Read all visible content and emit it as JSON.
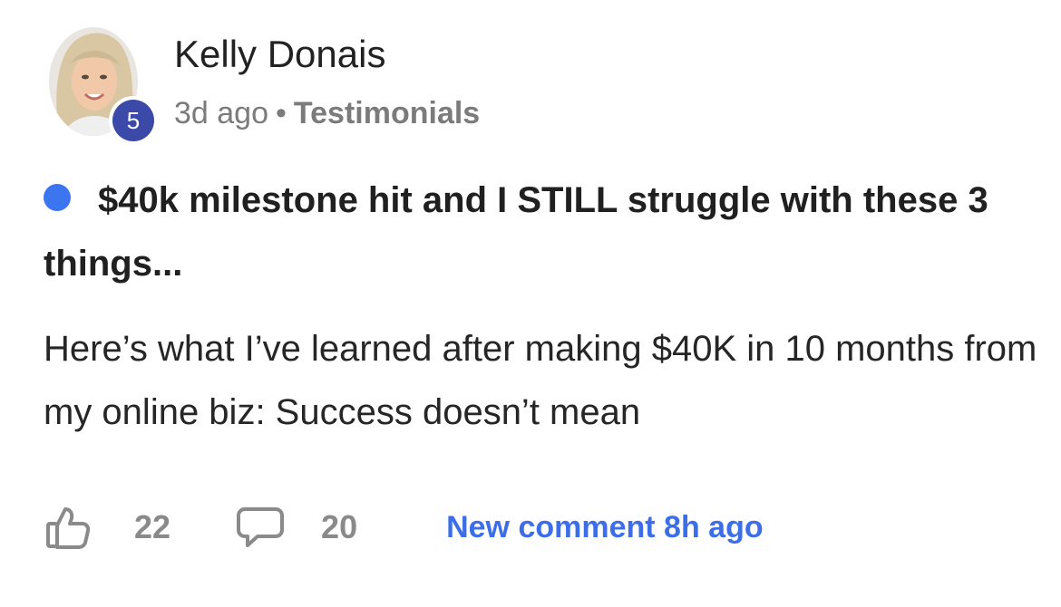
{
  "author": {
    "name": "Kelly Donais",
    "level": "5"
  },
  "meta": {
    "time_ago": "3d ago",
    "separator": "•",
    "category": "Testimonials"
  },
  "post": {
    "title": "$40k milestone hit and I STILL struggle with these 3 things...",
    "body": "Here’s what I’ve learned after making $40K in 10 months from my online biz: Success doesn’t mean",
    "unread": true
  },
  "actions": {
    "likes": "22",
    "comments": "20",
    "new_comment": "New comment 8h ago"
  },
  "icons": {
    "like": "thumbs-up-icon",
    "comment": "comment-bubble-icon"
  },
  "colors": {
    "unread_dot": "#3b76f0",
    "link": "#3b6ee8",
    "level_badge": "#3b4aa8",
    "muted_text": "#7b7b7b"
  }
}
